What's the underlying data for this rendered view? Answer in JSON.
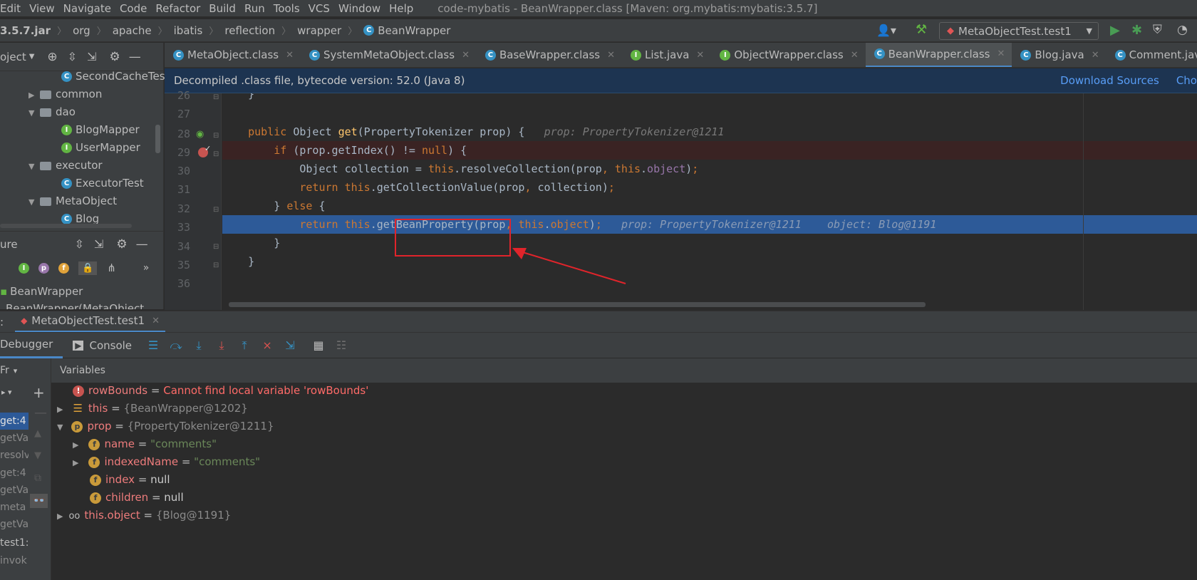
{
  "menu": {
    "items": [
      "Edit",
      "View",
      "Navigate",
      "Code",
      "Refactor",
      "Build",
      "Run",
      "Tools",
      "VCS",
      "Window",
      "Help"
    ],
    "window_title": "code-mybatis - BeanWrapper.class [Maven: org.mybatis:mybatis:3.5.7]"
  },
  "breadcrumb": {
    "items": [
      "3.5.7.jar",
      "org",
      "apache",
      "ibatis",
      "reflection",
      "wrapper",
      "BeanWrapper"
    ]
  },
  "run_config": {
    "label": "MetaObjectTest.test1"
  },
  "project_panel": {
    "header": "oject",
    "items": [
      {
        "label": "SecondCacheTes",
        "type": "class"
      },
      {
        "label": "common",
        "type": "folder"
      },
      {
        "label": "dao",
        "type": "folder"
      },
      {
        "label": "BlogMapper",
        "type": "interface"
      },
      {
        "label": "UserMapper",
        "type": "interface"
      },
      {
        "label": "executor",
        "type": "folder"
      },
      {
        "label": "ExecutorTest",
        "type": "class"
      },
      {
        "label": "MetaObject",
        "type": "folder"
      },
      {
        "label": "Blog",
        "type": "class"
      }
    ]
  },
  "structure_panel": {
    "header": "ure",
    "items": [
      "BeanWrapper",
      "BeanWrapper(MetaObject"
    ]
  },
  "tabs": [
    {
      "label": "MetaObject.class",
      "icon": "C"
    },
    {
      "label": "SystemMetaObject.class",
      "icon": "C"
    },
    {
      "label": "BaseWrapper.class",
      "icon": "C"
    },
    {
      "label": "List.java",
      "icon": "I"
    },
    {
      "label": "ObjectWrapper.class",
      "icon": "I"
    },
    {
      "label": "BeanWrapper.class",
      "icon": "C",
      "active": true
    },
    {
      "label": "Blog.java",
      "icon": "C"
    },
    {
      "label": "Comment.java",
      "icon": "C"
    }
  ],
  "banner": {
    "text": "Decompiled .class file, bytecode version: 52.0 (Java 8)",
    "download_sources": "Download Sources",
    "choose_sources": "Cho"
  },
  "code": {
    "line_numbers": [
      "26",
      "27",
      "28",
      "29",
      "30",
      "31",
      "32",
      "33",
      "34",
      "35",
      "36"
    ],
    "current_line": "33",
    "breakpoint_line": "29",
    "line28_hint": "prop: PropertyTokenizer@1211",
    "line33_hint_prop": "prop: PropertyTokenizer@1211",
    "line33_hint_object": "object: Blog@1191"
  },
  "debug": {
    "session_tab": "MetaObjectTest.test1",
    "debugger_tab": "Debugger",
    "console_tab": "Console",
    "variables_header": "Variables",
    "frames_header": "Fr",
    "frames": [
      "get:4",
      "getVa",
      "resolv",
      "get:4",
      "getVa",
      "meta",
      "getVa",
      "test1:",
      "invok"
    ],
    "variables": [
      {
        "name": "rowBounds",
        "eq": " = ",
        "value": "Cannot find local variable 'rowBounds'",
        "kind": "error"
      },
      {
        "name": "this",
        "eq": " = ",
        "value": "{BeanWrapper@1202}",
        "kind": "field-list"
      },
      {
        "name": "prop",
        "eq": " = ",
        "value": "{PropertyTokenizer@1211}",
        "kind": "param"
      },
      {
        "name": "name",
        "eq": " = ",
        "value": "\"comments\"",
        "kind": "field"
      },
      {
        "name": "indexedName",
        "eq": " = ",
        "value": "\"comments\"",
        "kind": "field"
      },
      {
        "name": "index",
        "eq": " = ",
        "value": "null",
        "kind": "field"
      },
      {
        "name": "children",
        "eq": " = ",
        "value": "null",
        "kind": "field"
      },
      {
        "name": "this.object",
        "eq": " = ",
        "value": "{Blog@1191}",
        "kind": "watch"
      }
    ]
  },
  "colors": {
    "annotation_red": "#e0242b",
    "selection_blue": "#2d5a98"
  }
}
